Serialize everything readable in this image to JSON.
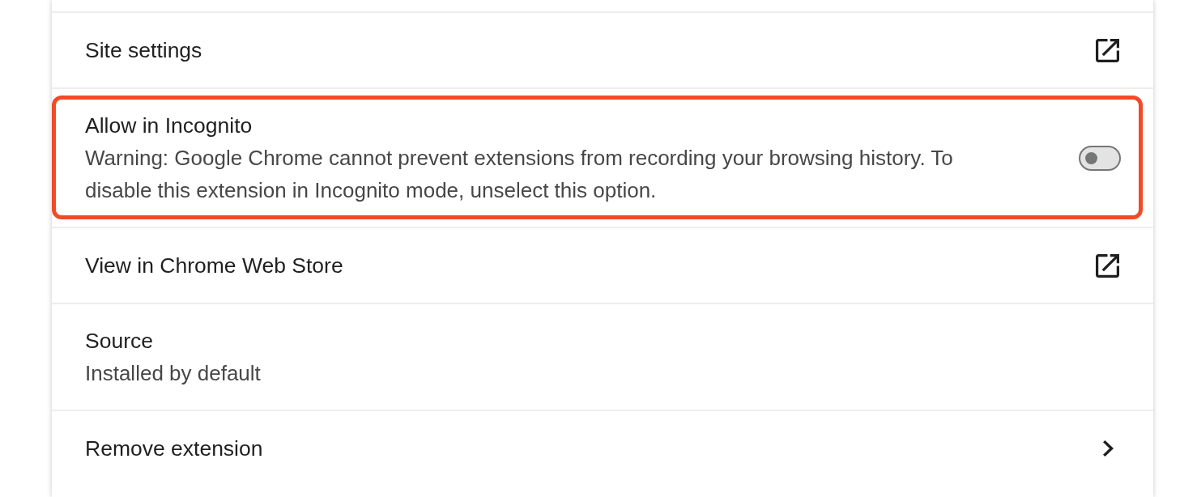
{
  "rows": [
    {
      "kind": "link",
      "label": "Site settings",
      "highlighted": false
    },
    {
      "kind": "toggle",
      "label": "Allow in Incognito",
      "description": "Warning: Google Chrome cannot prevent extensions from recording your browsing history. To disable this extension in Incognito mode, unselect this option.",
      "on": false,
      "highlighted": true
    },
    {
      "kind": "link",
      "label": "View in Chrome Web Store",
      "highlighted": false
    },
    {
      "kind": "info",
      "label": "Source",
      "description": "Installed by default",
      "highlighted": false
    },
    {
      "kind": "nav",
      "label": "Remove extension",
      "highlighted": false
    }
  ]
}
